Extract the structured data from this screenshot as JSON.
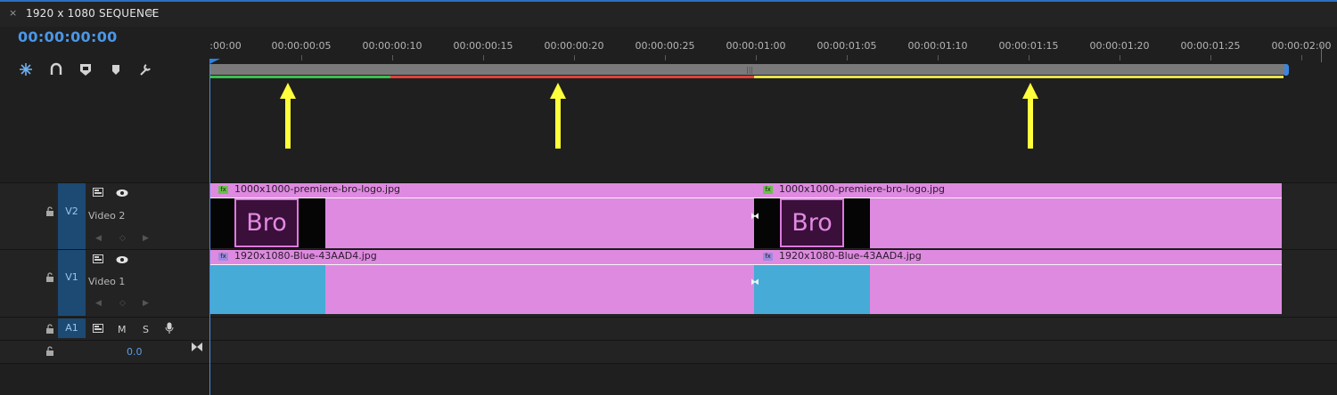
{
  "panel": {
    "close_glyph": "×",
    "title": "1920 x 1080 SEQUENCE",
    "menu_glyph": "≡",
    "timecode": "00:00:00:00"
  },
  "tools": [
    {
      "name": "snap-icon",
      "glyph": "⁂",
      "accent": true
    },
    {
      "name": "linked-selection-icon",
      "glyph": "∩",
      "accent": false
    },
    {
      "name": "add-marker-icon",
      "glyph": "◆",
      "accent": false
    },
    {
      "name": "marker-icon",
      "glyph": "⬢",
      "accent": false
    },
    {
      "name": "wrench-icon",
      "glyph": "🔧",
      "accent": false
    }
  ],
  "ruler": {
    "labels": [
      ":00:00",
      "00:00:00:05",
      "00:00:00:10",
      "00:00:00:15",
      "00:00:00:20",
      "00:00:00:25",
      "00:00:01:00",
      "00:00:01:05",
      "00:00:01:10",
      "00:00:01:15",
      "00:00:01:20",
      "00:00:01:25",
      "00:00:02:00"
    ]
  },
  "render_bar": [
    {
      "status": "rendered",
      "color": "#3bbf4f"
    },
    {
      "status": "unrendered-needs-render",
      "color": "#e0413c"
    },
    {
      "status": "unrendered-may-play",
      "color": "#e8e24a"
    }
  ],
  "annotation_arrow_color": "#ffff3b",
  "tracks": {
    "v2": {
      "target": "V2",
      "name": "Video 2",
      "lock_glyph": "🔓",
      "toggle_output_glyph": "👁",
      "sync_glyph": "▣"
    },
    "v1": {
      "target": "V1",
      "name": "Video 1",
      "lock_glyph": "🔓",
      "toggle_output_glyph": "👁",
      "sync_glyph": "▣"
    },
    "a1": {
      "target": "A1",
      "mute": "M",
      "solo": "S",
      "lock_glyph": "🔓",
      "voice_glyph": "🎙",
      "volume": "0.0",
      "sync_glyph": "▣"
    }
  },
  "clips": {
    "v2_a": {
      "name": "1000x1000-premiere-bro-logo.jpg",
      "thumb_text": "Bro",
      "fx": "fx"
    },
    "v2_b": {
      "name": "1000x1000-premiere-bro-logo.jpg",
      "thumb_text": "Bro",
      "fx": "fx"
    },
    "v1_a": {
      "name": "1920x1080-Blue-43AAD4.jpg",
      "fx": "fx"
    },
    "v1_b": {
      "name": "1920x1080-Blue-43AAD4.jpg",
      "fx": "fx"
    }
  },
  "colors": {
    "clip_pink": "#de8ae0",
    "clip_blue": "#46abd6",
    "accent_blue": "#4a97e8",
    "fx_green": "#6abf4b",
    "fx_purple": "#9c8ae0"
  }
}
